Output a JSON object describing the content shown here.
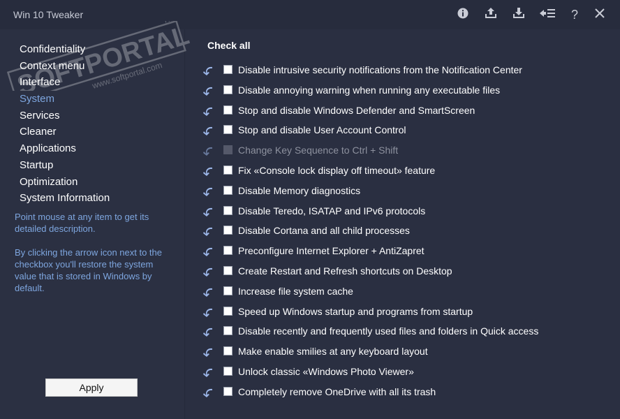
{
  "app": {
    "title": "Win 10 Tweaker"
  },
  "toolbar": {
    "icons": [
      {
        "name": "info-icon",
        "glyph": "ℹ"
      },
      {
        "name": "export-icon",
        "glyph": "⇧"
      },
      {
        "name": "import-icon",
        "glyph": "⇩"
      },
      {
        "name": "restore-all-icon",
        "glyph": "↶"
      },
      {
        "name": "help-icon",
        "glyph": "?"
      },
      {
        "name": "close-icon",
        "glyph": "✕"
      }
    ]
  },
  "sidebar": {
    "items": [
      {
        "label": "Confidentiality"
      },
      {
        "label": "Context menu"
      },
      {
        "label": "Interface"
      },
      {
        "label": "System"
      },
      {
        "label": "Services"
      },
      {
        "label": "Cleaner"
      },
      {
        "label": "Applications"
      },
      {
        "label": "Startup"
      },
      {
        "label": "Optimization"
      },
      {
        "label": "System Information"
      }
    ],
    "active_index": 3,
    "hint1": "Point mouse at any item to get its detailed description.",
    "hint2": "By clicking the arrow icon next to the checkbox you'll restore the system value that is stored in Windows by default.",
    "apply_label": "Apply"
  },
  "main": {
    "check_all_label": "Check all",
    "tweaks": [
      {
        "label": "Disable intrusive security notifications from the Notification Center",
        "enabled": true
      },
      {
        "label": "Disable annoying warning when running any executable files",
        "enabled": true
      },
      {
        "label": "Stop and disable Windows Defender and SmartScreen",
        "enabled": true
      },
      {
        "label": "Stop and disable User Account Control",
        "enabled": true
      },
      {
        "label": "Change Key Sequence to Ctrl + Shift",
        "enabled": false
      },
      {
        "label": "Fix «Console lock display off timeout» feature",
        "enabled": true
      },
      {
        "label": "Disable Memory diagnostics",
        "enabled": true
      },
      {
        "label": "Disable Teredo, ISATAP and IPv6 protocols",
        "enabled": true
      },
      {
        "label": "Disable Cortana and all child processes",
        "enabled": true
      },
      {
        "label": "Preconfigure Internet Explorer + AntiZapret",
        "enabled": true
      },
      {
        "label": "Create Restart and Refresh shortcuts on Desktop",
        "enabled": true
      },
      {
        "label": "Increase file system cache",
        "enabled": true
      },
      {
        "label": "Speed up Windows startup and programs from startup",
        "enabled": true
      },
      {
        "label": "Disable recently and frequently used files and folders in Quick access",
        "enabled": true
      },
      {
        "label": "Make enable smilies at any keyboard layout",
        "enabled": true
      },
      {
        "label": "Unlock classic «Windows Photo Viewer»",
        "enabled": true
      },
      {
        "label": "Completely remove OneDrive with all its trash",
        "enabled": true
      }
    ]
  },
  "watermark": {
    "brand": "SOFTPORTAL",
    "tm": "TM",
    "site": "www.softportal.com"
  },
  "colors": {
    "accent": "#7ea6df",
    "background": "#2a2f41",
    "titlebar": "#272c3d"
  }
}
